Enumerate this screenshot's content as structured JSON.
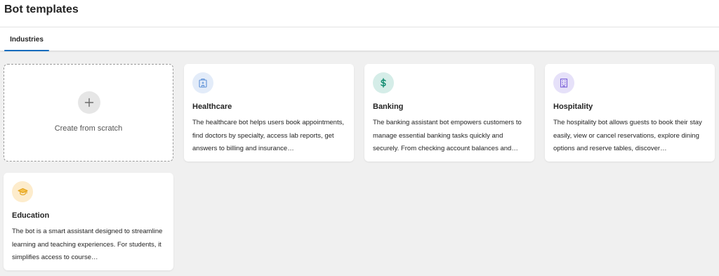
{
  "page": {
    "title": "Bot templates"
  },
  "tabs": [
    {
      "label": "Industries",
      "active": true
    }
  ],
  "scratch": {
    "label": "Create from scratch",
    "icon": "plus-icon"
  },
  "templates": [
    {
      "title": "Healthcare",
      "icon": "hospital-icon",
      "icon_bg": "#e3ecf9",
      "icon_color": "#5b8fd6",
      "description": "The healthcare bot helps users book appointments, find doctors by specialty, access lab reports, get answers to billing and insurance…"
    },
    {
      "title": "Banking",
      "icon": "dollar-icon",
      "icon_bg": "#d5ede8",
      "icon_color": "#0e8a6e",
      "description": "The banking assistant bot empowers customers to manage essential banking tasks quickly and securely. From checking account balances and…"
    },
    {
      "title": "Hospitality",
      "icon": "building-icon",
      "icon_bg": "#e6e1f9",
      "icon_color": "#7a5fd8",
      "description": "The hospitality bot allows guests to book their stay easily, view or cancel reservations, explore dining options and reserve tables, discover…"
    },
    {
      "title": "Education",
      "icon": "graduation-cap-icon",
      "icon_bg": "#fdeccc",
      "icon_color": "#e3a21a",
      "description": "The bot is a smart assistant designed to streamline learning and teaching experiences. For students, it simplifies access to course…"
    }
  ]
}
